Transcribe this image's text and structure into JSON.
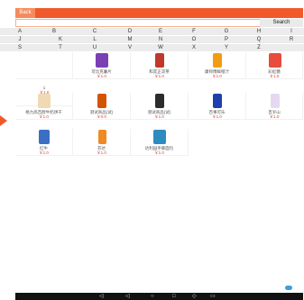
{
  "topbar": {
    "back_label": "Back"
  },
  "search": {
    "button_label": "Search",
    "placeholder": ""
  },
  "letter_rows": [
    [
      "A",
      "B",
      "C",
      "D",
      "E",
      "F",
      "G",
      "H",
      "I"
    ],
    [
      "J",
      "K",
      "L",
      "M",
      "N",
      "O",
      "P",
      "Q",
      "R"
    ],
    [
      "S",
      "T",
      "U",
      "V",
      "W",
      "X",
      "Y",
      "Z"
    ]
  ],
  "products": [
    {
      "name": "",
      "price": "",
      "color": "#ffffff"
    },
    {
      "name": "可比克薯片",
      "price": "￥1.0",
      "color": "#7b3fb5"
    },
    {
      "name": "和其正凉茶",
      "price": "￥1.0",
      "color": "#c0392b"
    },
    {
      "name": "康师傅鲜橙汁",
      "price": "￥1.0",
      "color": "#f39c12"
    },
    {
      "name": "彩虹糖",
      "price": "￥1.0",
      "color": "#e74c3c"
    },
    {
      "name": "1",
      "price": "￥1.0",
      "color": "#ffffff"
    },
    {
      "name": "",
      "price": "",
      "color": "#ffffff"
    },
    {
      "name": "",
      "price": "",
      "color": "#ffffff"
    },
    {
      "name": "",
      "price": "",
      "color": "#ffffff"
    },
    {
      "name": "",
      "price": "",
      "color": "#ffffff"
    },
    {
      "name": "格力高百醇牛奶饼干",
      "price": "￥1.0",
      "color": "#f0d9b5"
    },
    {
      "name": "测试商品(试)",
      "price": "￥0.0",
      "color": "#d35400"
    },
    {
      "name": "测试商品(试)",
      "price": "￥1.0",
      "color": "#2c2c2c"
    },
    {
      "name": "百事可乐",
      "price": "￥1.0",
      "color": "#1f3fae"
    },
    {
      "name": "百岁山",
      "price": "￥1.0",
      "color": "#e5d9f2"
    },
    {
      "name": "红牛",
      "price": "￥1.0",
      "color": "#3a6fc4"
    },
    {
      "name": "芬达",
      "price": "￥1.0",
      "color": "#f08a24"
    },
    {
      "name": "达利园手撕面包",
      "price": "￥1.0",
      "color": "#2e8bc0"
    }
  ]
}
